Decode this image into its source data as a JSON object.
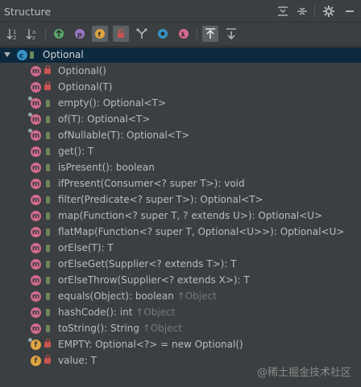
{
  "panel": {
    "title": "Structure"
  },
  "tree": {
    "root": "Optional",
    "members": [
      {
        "label": "Optional()",
        "kind": "method",
        "access": "private"
      },
      {
        "label": "Optional(T)",
        "kind": "method",
        "access": "private"
      },
      {
        "label": "empty(): Optional<T>",
        "kind": "method",
        "access": "public",
        "static": true
      },
      {
        "label": "of(T): Optional<T>",
        "kind": "method",
        "access": "public",
        "static": true
      },
      {
        "label": "ofNullable(T): Optional<T>",
        "kind": "method",
        "access": "public",
        "static": true
      },
      {
        "label": "get(): T",
        "kind": "method",
        "access": "public"
      },
      {
        "label": "isPresent(): boolean",
        "kind": "method",
        "access": "public"
      },
      {
        "label": "ifPresent(Consumer<? super T>): void",
        "kind": "method",
        "access": "public"
      },
      {
        "label": "filter(Predicate<? super T>): Optional<T>",
        "kind": "method",
        "access": "public"
      },
      {
        "label": "map(Function<? super T, ? extends U>): Optional<U>",
        "kind": "method",
        "access": "public"
      },
      {
        "label": "flatMap(Function<? super T, Optional<U>>): Optional<U>",
        "kind": "method",
        "access": "public"
      },
      {
        "label": "orElse(T): T",
        "kind": "method",
        "access": "public"
      },
      {
        "label": "orElseGet(Supplier<? extends T>): T",
        "kind": "method",
        "access": "public"
      },
      {
        "label": "orElseThrow(Supplier<? extends X>): T",
        "kind": "method",
        "access": "public"
      },
      {
        "label": "equals(Object): boolean",
        "inherited": "↑Object",
        "kind": "method",
        "access": "public"
      },
      {
        "label": "hashCode(): int",
        "inherited": "↑Object",
        "kind": "method",
        "access": "public"
      },
      {
        "label": "toString(): String",
        "inherited": "↑Object",
        "kind": "method",
        "access": "public"
      },
      {
        "label": "EMPTY: Optional<?> = new Optional()",
        "kind": "field",
        "access": "private",
        "static": true
      },
      {
        "label": "value: T",
        "kind": "field",
        "access": "private"
      }
    ]
  },
  "watermark": "@稀土掘金技术社区"
}
